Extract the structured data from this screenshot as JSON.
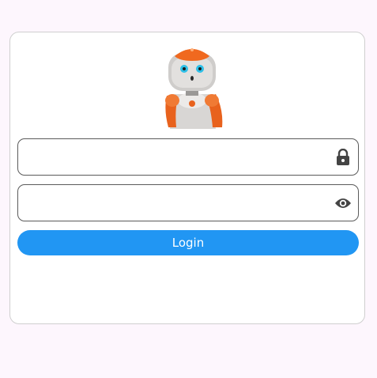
{
  "login_form": {
    "username": {
      "value": "",
      "placeholder": "",
      "icon": "lock-icon"
    },
    "password": {
      "value": "",
      "placeholder": "",
      "icon": "eye-icon"
    },
    "login_label": "Login"
  },
  "colors": {
    "background": "#fdf6fd",
    "card_border": "#cfcfcf",
    "primary": "#2196f3",
    "robot_accent": "#f26b21"
  }
}
